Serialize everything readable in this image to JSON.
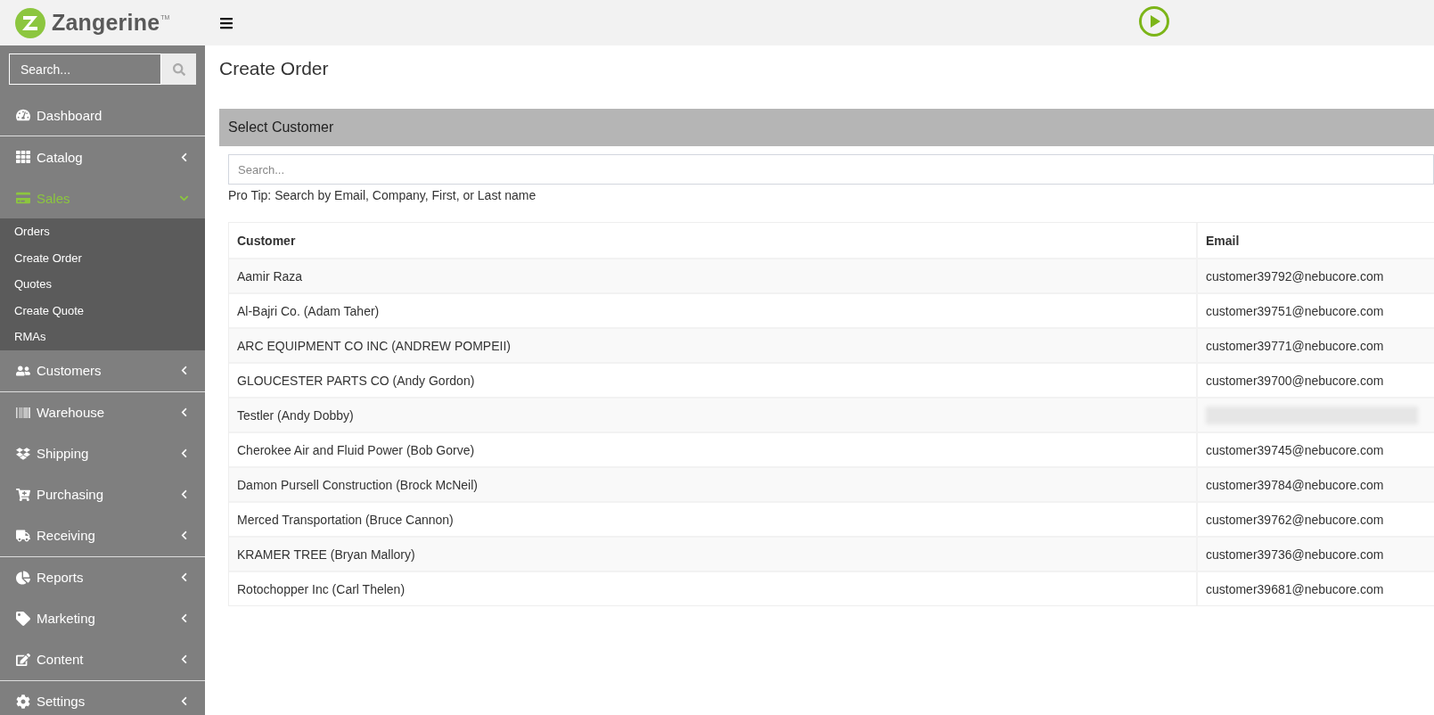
{
  "brand": {
    "name": "Zangerine",
    "mark": "TM"
  },
  "sidebar": {
    "search": {
      "placeholder": "Search..."
    },
    "sections": [
      {
        "items": [
          {
            "label": "Dashboard",
            "kind": "link"
          }
        ]
      },
      {
        "items": [
          {
            "label": "Catalog",
            "kind": "group",
            "expanded": false
          },
          {
            "label": "Sales",
            "kind": "group",
            "expanded": true,
            "children": [
              {
                "label": "Orders"
              },
              {
                "label": "Create Order"
              },
              {
                "label": "Quotes"
              },
              {
                "label": "Create Quote"
              },
              {
                "label": "RMAs"
              }
            ]
          },
          {
            "label": "Customers",
            "kind": "group",
            "expanded": false
          }
        ]
      },
      {
        "items": [
          {
            "label": "Warehouse",
            "kind": "group",
            "expanded": false
          },
          {
            "label": "Shipping",
            "kind": "group",
            "expanded": false
          },
          {
            "label": "Purchasing",
            "kind": "group",
            "expanded": false
          },
          {
            "label": "Receiving",
            "kind": "group",
            "expanded": false
          }
        ]
      },
      {
        "items": [
          {
            "label": "Reports",
            "kind": "group",
            "expanded": false
          },
          {
            "label": "Marketing",
            "kind": "group",
            "expanded": false
          },
          {
            "label": "Content",
            "kind": "group",
            "expanded": false
          }
        ]
      },
      {
        "items": [
          {
            "label": "Settings",
            "kind": "group",
            "expanded": false
          }
        ]
      }
    ]
  },
  "page": {
    "title": "Create Order",
    "panel": {
      "title": "Select Customer",
      "search": {
        "placeholder": "Search..."
      },
      "tip": "Pro Tip: Search by Email, Company, First, or Last name"
    },
    "table": {
      "columns": [
        "Customer",
        "Email"
      ],
      "rows": [
        {
          "customer": "Aamir Raza",
          "email": "customer39792@nebucore.com",
          "redacted": false
        },
        {
          "customer": "Al-Bajri Co. (Adam Taher)",
          "email": "customer39751@nebucore.com",
          "redacted": false
        },
        {
          "customer": "ARC EQUIPMENT CO INC (ANDREW POMPEII)",
          "email": "customer39771@nebucore.com",
          "redacted": false
        },
        {
          "customer": "GLOUCESTER PARTS CO (Andy Gordon)",
          "email": "customer39700@nebucore.com",
          "redacted": false
        },
        {
          "customer": "Testler (Andy Dobby)",
          "redacted": true
        },
        {
          "customer": "Cherokee Air and Fluid Power (Bob Gorve)",
          "email": "customer39745@nebucore.com",
          "redacted": false
        },
        {
          "customer": "Damon Pursell Construction (Brock McNeil)",
          "email": "customer39784@nebucore.com",
          "redacted": false
        },
        {
          "customer": "Merced Transportation (Bruce Cannon)",
          "email": "customer39762@nebucore.com",
          "redacted": false
        },
        {
          "customer": "KRAMER TREE (Bryan Mallory)",
          "email": "customer39736@nebucore.com",
          "redacted": false
        },
        {
          "customer": "Rotochopper Inc (Carl Thelen)",
          "email": "customer39681@nebucore.com",
          "redacted": false
        }
      ]
    }
  }
}
